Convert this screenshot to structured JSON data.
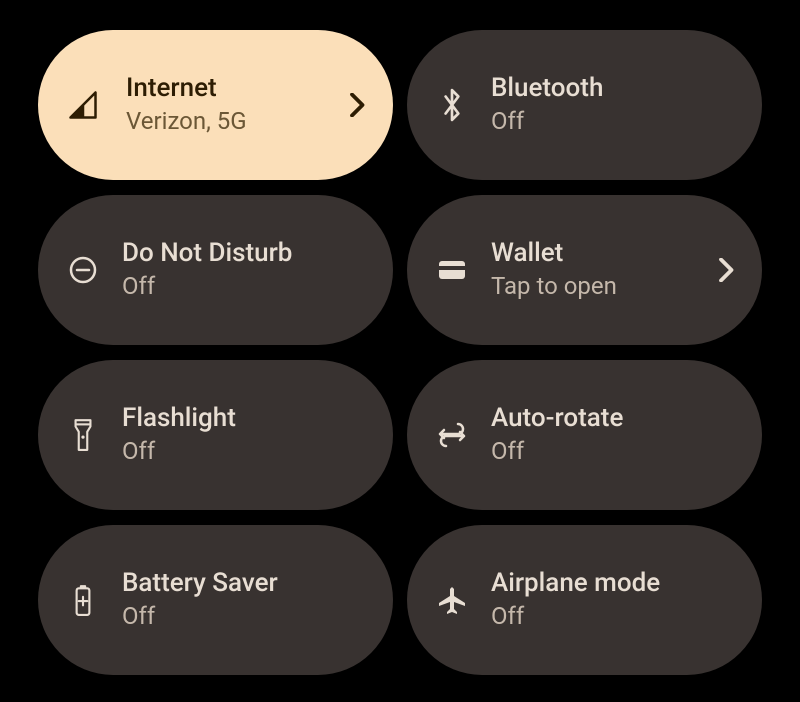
{
  "quickSettings": {
    "tiles": [
      {
        "title": "Internet",
        "subtitle": "Verizon, 5G",
        "active": true,
        "hasChevron": true
      },
      {
        "title": "Bluetooth",
        "subtitle": "Off",
        "active": false,
        "hasChevron": false
      },
      {
        "title": "Do Not Disturb",
        "subtitle": "Off",
        "active": false,
        "hasChevron": false
      },
      {
        "title": "Wallet",
        "subtitle": "Tap to open",
        "active": false,
        "hasChevron": true
      },
      {
        "title": "Flashlight",
        "subtitle": "Off",
        "active": false,
        "hasChevron": false
      },
      {
        "title": "Auto-rotate",
        "subtitle": "Off",
        "active": false,
        "hasChevron": false
      },
      {
        "title": "Battery Saver",
        "subtitle": "Off",
        "active": false,
        "hasChevron": false
      },
      {
        "title": "Airplane mode",
        "subtitle": "Off",
        "active": false,
        "hasChevron": false
      }
    ]
  },
  "colors": {
    "activeBackground": "#fbdfb9",
    "inactiveBackground": "#383230",
    "activeText": "#2d1d03",
    "inactiveText": "#e8ded3"
  }
}
